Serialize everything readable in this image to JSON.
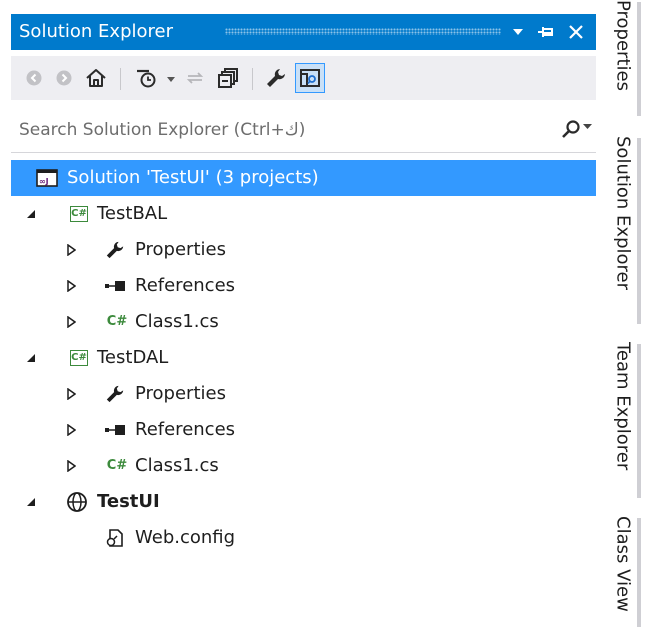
{
  "window": {
    "title": "Solution Explorer",
    "dropdown_icon": "dropdown-arrow-icon",
    "pin_icon": "pin-icon",
    "close_icon": "close-icon"
  },
  "toolbar": {
    "buttons": [
      {
        "name": "back-button",
        "icon": "back-icon"
      },
      {
        "name": "forward-button",
        "icon": "forward-icon"
      },
      {
        "name": "home-button",
        "icon": "home-icon"
      },
      {
        "name": "pending-changes-filter-button",
        "icon": "clock-filter-icon"
      },
      {
        "name": "sync-with-active-document-button",
        "icon": "sync-icon"
      },
      {
        "name": "collapse-all-button",
        "icon": "collapse-all-icon"
      },
      {
        "name": "properties-button",
        "icon": "wrench-icon"
      },
      {
        "name": "preview-selected-items-button",
        "icon": "preview-icon"
      }
    ]
  },
  "search": {
    "placeholder": "Search Solution Explorer (Ctrl+ك)"
  },
  "tree": {
    "solution": "Solution 'TestUI' (3 projects)",
    "projects": [
      {
        "name": "TestBAL",
        "children": [
          "Properties",
          "References",
          "Class1.cs"
        ]
      },
      {
        "name": "TestDAL",
        "children": [
          "Properties",
          "References",
          "Class1.cs"
        ]
      },
      {
        "name": "TestUI",
        "children": [
          "Web.config"
        ]
      }
    ]
  },
  "side_tabs": [
    "Properties",
    "Solution Explorer",
    "Team Explorer",
    "Class View"
  ],
  "colors": {
    "accent": "#007acc",
    "selection": "#3399ff",
    "toolbar_bg": "#eeeef2",
    "csharp_green": "#3c8a3c"
  }
}
